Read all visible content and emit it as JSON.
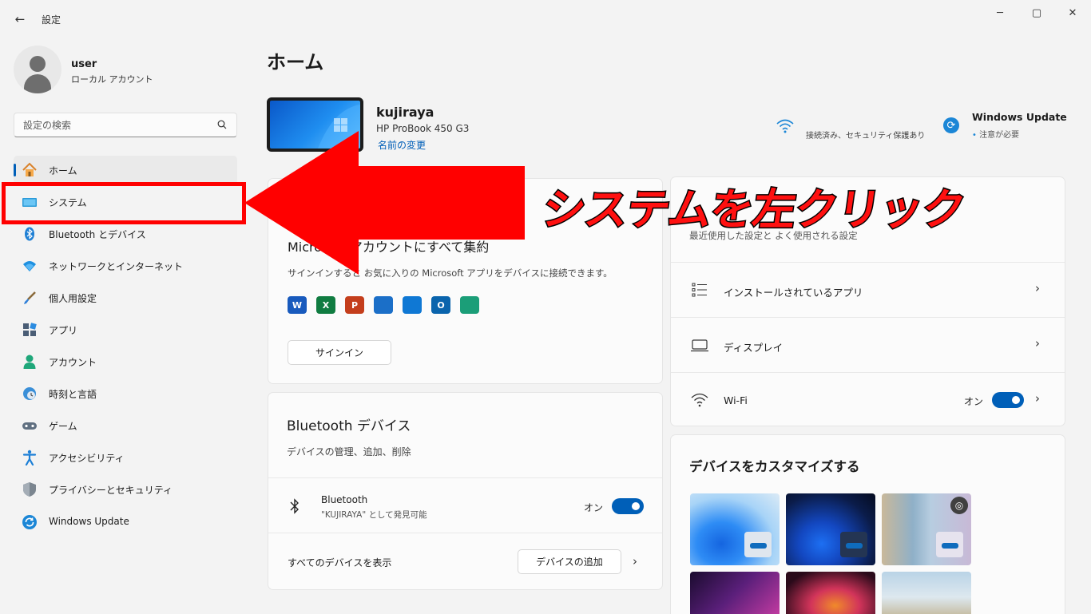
{
  "window": {
    "title": "設定",
    "back_glyph": "←",
    "minimize_glyph": "─",
    "maximize_glyph": "▢",
    "close_glyph": "✕"
  },
  "profile": {
    "name": "user",
    "account_type": "ローカル アカウント"
  },
  "search": {
    "placeholder": "設定の検索"
  },
  "sidebar": {
    "items": [
      {
        "label": "ホーム",
        "icon": "home-icon"
      },
      {
        "label": "システム",
        "icon": "system-icon"
      },
      {
        "label": "Bluetooth とデバイス",
        "icon": "bluetooth-icon"
      },
      {
        "label": "ネットワークとインターネット",
        "icon": "network-icon"
      },
      {
        "label": "個人用設定",
        "icon": "brush-icon"
      },
      {
        "label": "アプリ",
        "icon": "apps-icon"
      },
      {
        "label": "アカウント",
        "icon": "account-icon"
      },
      {
        "label": "時刻と言語",
        "icon": "time-language-icon"
      },
      {
        "label": "ゲーム",
        "icon": "game-icon"
      },
      {
        "label": "アクセシビリティ",
        "icon": "accessibility-icon"
      },
      {
        "label": "プライバシーとセキュリティ",
        "icon": "shield-icon"
      },
      {
        "label": "Windows Update",
        "icon": "windows-update-icon"
      }
    ],
    "active_index": 0
  },
  "main": {
    "title": "ホーム",
    "device": {
      "name": "kujiraya",
      "model": "HP ProBook 450 G3",
      "rename_link": "名前の変更"
    },
    "status": {
      "wifi_text": "接続済み、セキュリティ保護あり",
      "update_title": "Windows Update",
      "update_sub": "注意が必要"
    },
    "microsoft_account": {
      "heading": "Microsoft アカウントにすべて集約",
      "description": "サインインすると お気に入りの Microsoft アプリをデバイスに接続できます。",
      "apps": [
        {
          "name": "word-icon",
          "letter": "W",
          "color": "#185abd"
        },
        {
          "name": "excel-icon",
          "letter": "X",
          "color": "#107c41"
        },
        {
          "name": "powerpoint-icon",
          "letter": "P",
          "color": "#c43e1c"
        },
        {
          "name": "defender-icon",
          "letter": "",
          "color": "#1b6fc8"
        },
        {
          "name": "onedrive-icon",
          "letter": "",
          "color": "#0f78d4"
        },
        {
          "name": "outlook-icon",
          "letter": "O",
          "color": "#0a64ad"
        },
        {
          "name": "family-icon",
          "letter": "",
          "color": "#1b9e78"
        }
      ],
      "signin_label": "サインイン"
    },
    "bluetooth": {
      "title": "Bluetooth デバイス",
      "description": "デバイスの管理、追加、削除",
      "device_name": "Bluetooth",
      "device_sub": "\"KUJIRAYA\" として発見可能",
      "toggle_label": "オン",
      "toggle_on": true,
      "show_all": "すべてのデバイスを表示",
      "add_device": "デバイスの追加"
    },
    "recommended": {
      "subtitle": "最近使用した設定と よく使用される設定",
      "rows": [
        {
          "label": "インストールされているアプリ",
          "icon": "apps-list-icon"
        },
        {
          "label": "ディスプレイ",
          "icon": "display-icon"
        },
        {
          "label": "Wi-Fi",
          "icon": "wifi-icon",
          "toggle_label": "オン",
          "toggle_on": true
        }
      ]
    },
    "customize": {
      "title": "デバイスをカスタマイズする"
    }
  },
  "annotation": {
    "text": "システムを左クリック",
    "color": "#ff1010"
  }
}
